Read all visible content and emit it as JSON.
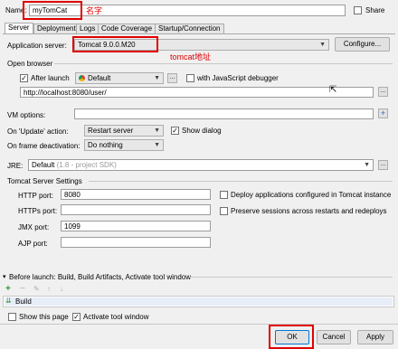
{
  "name": {
    "label": "Name:",
    "value": "myTomCat",
    "annotation": "名字"
  },
  "share": {
    "label": "Share"
  },
  "tabs": [
    "Server",
    "Deployment",
    "Logs",
    "Code Coverage",
    "Startup/Connection"
  ],
  "app_server": {
    "label": "Application server:",
    "value": "Tomcat 9.0.0.M20",
    "configure": "Configure...",
    "annotation": "tomcat地址"
  },
  "open_browser": {
    "section": "Open browser",
    "after_launch": "After launch",
    "browser": "Default",
    "dots": "...",
    "js_debugger": "with JavaScript debugger",
    "url": "http://localhost:8080/user/"
  },
  "vm_options": {
    "label": "VM options:"
  },
  "on_update": {
    "label": "On 'Update' action:",
    "value": "Restart server",
    "show_dialog": "Show dialog"
  },
  "on_frame": {
    "label": "On frame deactivation:",
    "value": "Do nothing"
  },
  "jre": {
    "label": "JRE:",
    "value": "Default",
    "hint": "(1.8 - project SDK)"
  },
  "tomcat_settings": {
    "section": "Tomcat Server Settings",
    "http_port_label": "HTTP port:",
    "http_port": "8080",
    "https_port_label": "HTTPs port:",
    "https_port": "",
    "jmx_port_label": "JMX port:",
    "jmx_port": "1099",
    "ajp_port_label": "AJP port:",
    "ajp_port": "",
    "deploy_option": "Deploy applications configured in Tomcat instance",
    "preserve_option": "Preserve sessions across restarts and redeploys"
  },
  "before_launch": {
    "section": "Before launch: Build, Build Artifacts, Activate tool window",
    "item": "Build",
    "show_page": "Show this page",
    "activate_tool": "Activate tool window"
  },
  "buttons": {
    "ok": "OK",
    "cancel": "Cancel",
    "apply": "Apply"
  }
}
